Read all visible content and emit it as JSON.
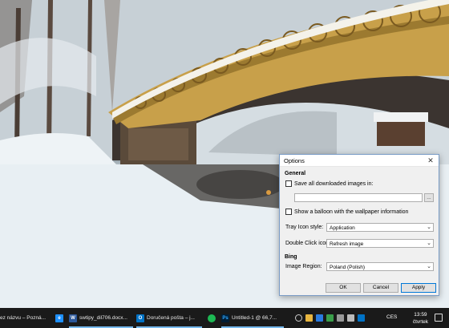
{
  "dialog": {
    "title": "Options",
    "close_glyph": "✕",
    "general_header": "General",
    "save_images_label": "Save all downloaded images in:",
    "save_images_checked": false,
    "save_path_value": "",
    "browse_label": "...",
    "balloon_label": "Show a balloon with the wallpaper information",
    "balloon_checked": false,
    "tray_icon_label": "Tray Icon style:",
    "tray_icon_value": "Application",
    "double_click_label": "Double Click icon:",
    "double_click_value": "Refresh image",
    "bing_header": "Bing",
    "image_region_label": "Image Region:",
    "image_region_value": "Poland (Polish)",
    "ok_label": "OK",
    "cancel_label": "Cancel",
    "apply_label": "Apply"
  },
  "taskbar": {
    "tasks": [
      {
        "label": "ez názvu – Pozná...",
        "icon": "document-icon"
      },
      {
        "label": "",
        "icon": "edge-icon"
      },
      {
        "label": "swtipy_dil706.docx...",
        "icon": "word-icon"
      },
      {
        "label": "Doručená pošta – j...",
        "icon": "outlook-icon"
      },
      {
        "label": "",
        "icon": "spotify-icon"
      },
      {
        "label": "Untitled-1 @ 66,7...",
        "icon": "photoshop-icon"
      }
    ],
    "language": "CES",
    "time": "13:59",
    "day": "čtvrtek",
    "colors": {
      "word": "#2b579a",
      "outlook": "#0072c6",
      "spotify": "#1db954",
      "photoshop": "#001e36",
      "edge": "#1e90ff",
      "accent": "#76b9ed"
    }
  }
}
